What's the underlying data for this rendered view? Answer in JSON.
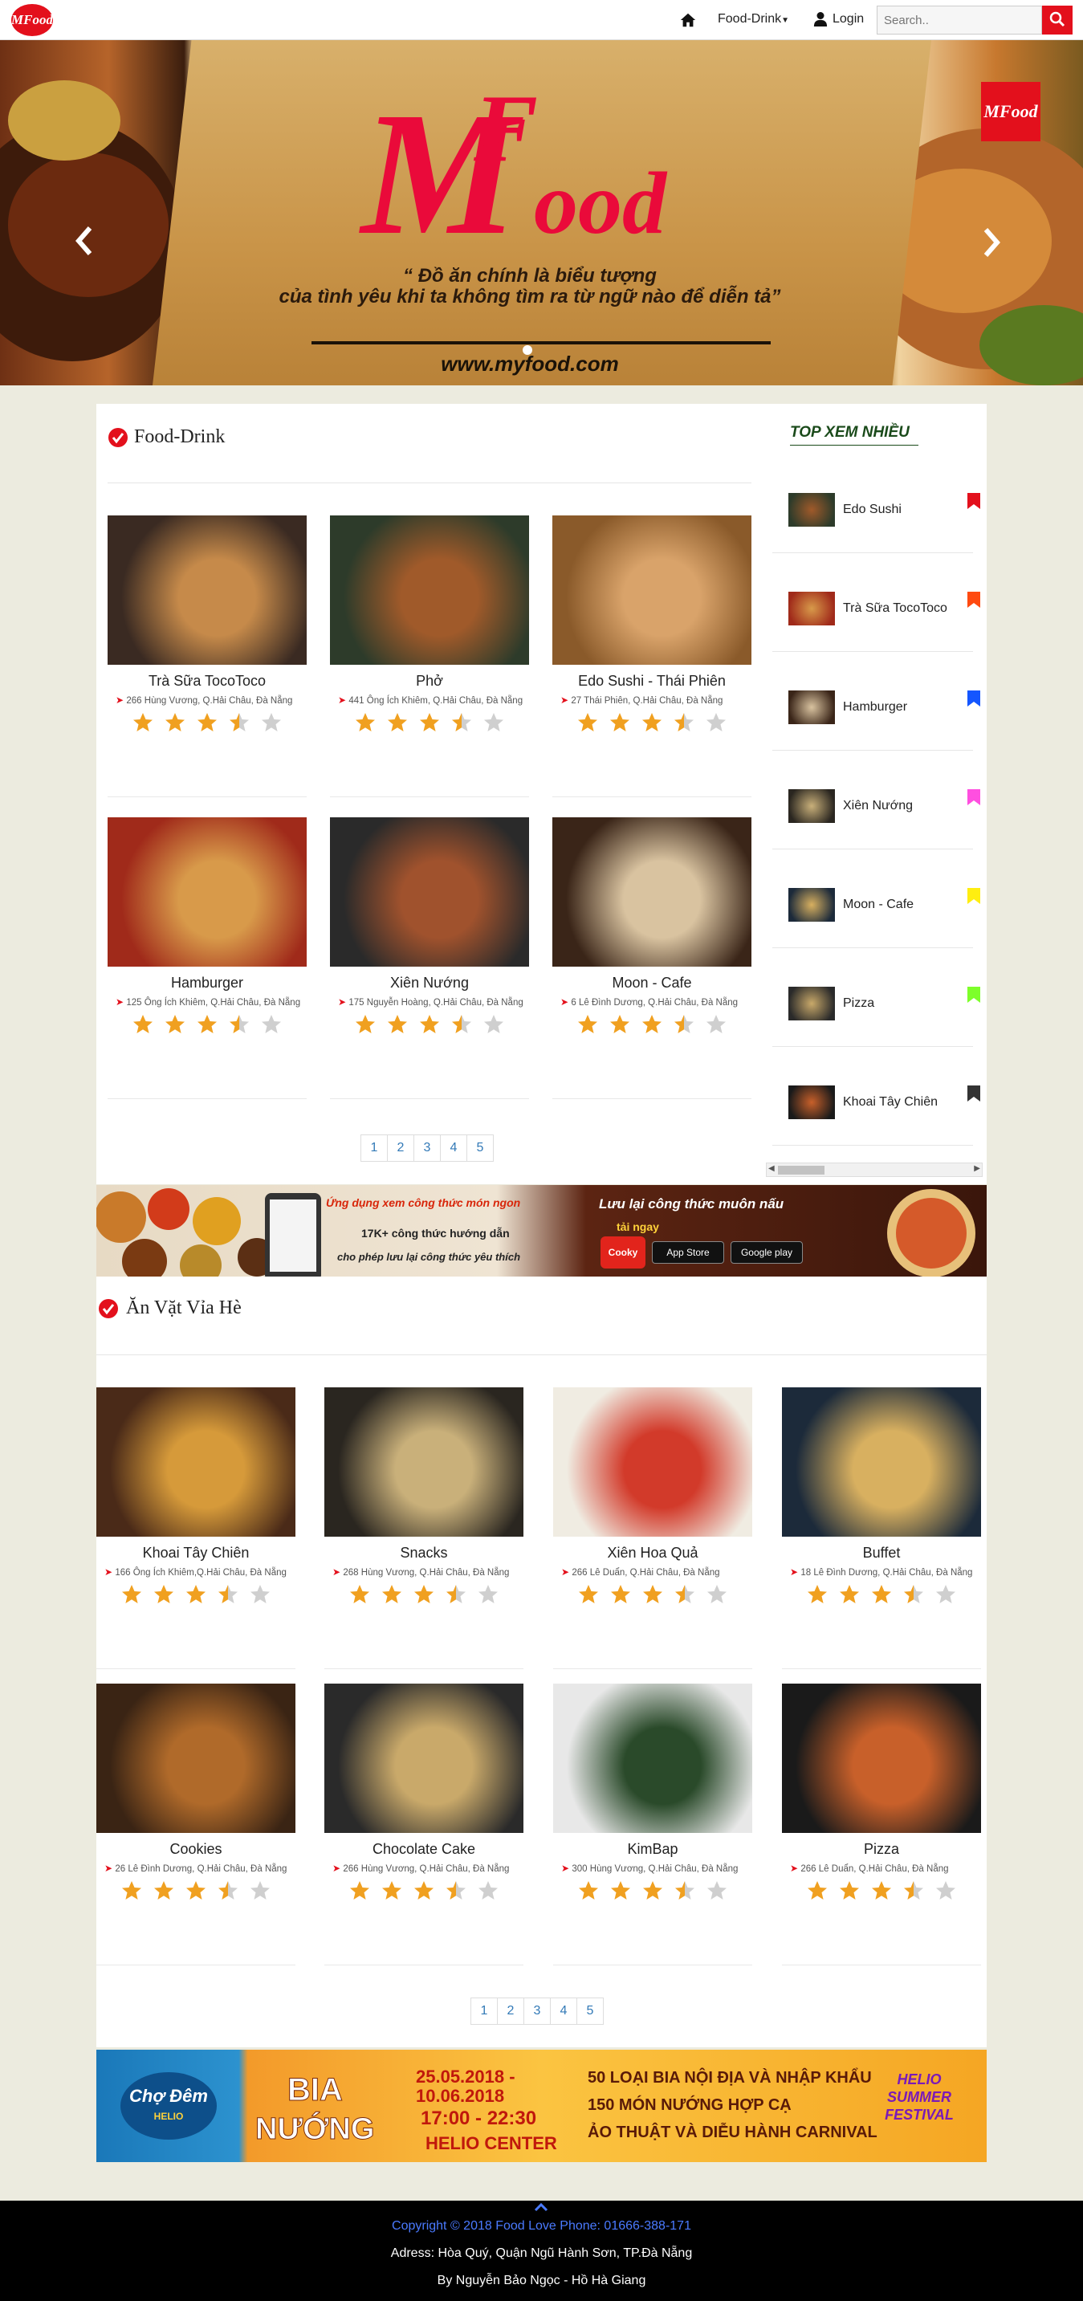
{
  "nav": {
    "logo_text": "MFood",
    "food_drink_label": "Food-Drink",
    "login_label": "Login",
    "search_placeholder": "Search.."
  },
  "hero": {
    "brand": "MFood",
    "quote_line1": "“ Đồ ăn chính là biểu tượng",
    "quote_line2": "của tình yêu khi ta không tìm ra từ ngữ nào để diễn tả”",
    "website": "www.myfood.com",
    "badge": "MFood"
  },
  "section_food_drink": {
    "title": "Food-Drink",
    "items": [
      {
        "name": "Trà Sữa TocoToco",
        "address": "266 Hùng Vương, Q.Hải Châu, Đà Nẵng",
        "rating": 3.5
      },
      {
        "name": "Phở",
        "address": "441 Ông Ích Khiêm, Q.Hải Châu, Đà Nẵng",
        "rating": 3.5
      },
      {
        "name": "Edo Sushi - Thái Phiên",
        "address": "27 Thái Phiên, Q.Hải Châu, Đà Nẵng",
        "rating": 3.5
      },
      {
        "name": "Hamburger",
        "address": "125 Ông Ích Khiêm, Q.Hải Châu, Đà Nẵng",
        "rating": 3.5
      },
      {
        "name": "Xiên Nướng",
        "address": "175 Nguyễn Hoàng, Q.Hải Châu, Đà Nẵng",
        "rating": 3.5
      },
      {
        "name": "Moon - Cafe",
        "address": "6 Lê Đình Dương, Q.Hải Châu, Đà Nẵng",
        "rating": 3.5
      }
    ],
    "pages": [
      "1",
      "2",
      "3",
      "4",
      "5"
    ]
  },
  "top_views": {
    "title": "TOP XEM NHIỀU",
    "items": [
      {
        "label": "Edo Sushi",
        "flag_color": "#e3101c"
      },
      {
        "label": "Trà Sữa TocoToco",
        "flag_color": "#ff4a10"
      },
      {
        "label": "Hamburger",
        "flag_color": "#1456ff"
      },
      {
        "label": "Xiên Nướng",
        "flag_color": "#ff4fe0"
      },
      {
        "label": "Moon - Cafe",
        "flag_color": "#ffee10"
      },
      {
        "label": "Pizza",
        "flag_color": "#7dff2a"
      },
      {
        "label": "Khoai Tây Chiên",
        "flag_color": "#333333"
      }
    ]
  },
  "ad_cooky": {
    "left_heading": "Ứng dụng xem công thức món ngon",
    "left_line1": "17K+ công thức hướng dẫn",
    "left_line2": "cho phép lưu lại công thức yêu thích",
    "right_heading": "Lưu lại công thức muôn nấu",
    "right_cta": "tải ngay",
    "brand": "Cooky",
    "app_store": "App Store",
    "google_play": "Google play"
  },
  "section_an_vat": {
    "title": "Ăn Vặt Vỉa Hè",
    "items": [
      {
        "name": "Khoai Tây Chiên",
        "address": "166 Ông Ích Khiêm,Q.Hải Châu, Đà Nẵng",
        "rating": 3.5
      },
      {
        "name": "Snacks",
        "address": "268 Hùng Vương, Q.Hải Châu, Đà Nẵng",
        "rating": 3.5
      },
      {
        "name": "Xiên Hoa Quả",
        "address": "266 Lê Duẩn, Q.Hải Châu, Đà Nẵng",
        "rating": 3.5
      },
      {
        "name": "Buffet",
        "address": "18 Lê Đình Dương, Q.Hải Châu, Đà Nẵng",
        "rating": 3.5
      },
      {
        "name": "Cookies",
        "address": "26 Lê Đình Dương, Q.Hải Châu, Đà Nẵng",
        "rating": 3.5
      },
      {
        "name": "Chocolate Cake",
        "address": "266 Hùng Vương, Q.Hải Châu, Đà Nẵng",
        "rating": 3.5
      },
      {
        "name": "KimBap",
        "address": "300 Hùng Vương, Q.Hải Châu, Đà Nẵng",
        "rating": 3.5
      },
      {
        "name": "Pizza",
        "address": "266 Lê Duẩn, Q.Hải Châu, Đà Nẵng",
        "rating": 3.5
      }
    ],
    "pages": [
      "1",
      "2",
      "3",
      "4",
      "5"
    ]
  },
  "ad_festival": {
    "brand": "Chợ Đêm",
    "brand_sub": "HELIO",
    "event_name_1": "BIA",
    "event_name_2": "NƯỚNG",
    "dates": "25.05.2018 - 10.06.2018",
    "time": "17:00 - 22:30",
    "venue": "HELIO CENTER",
    "line1": "50 LOẠI BIA NỘI ĐỊA VÀ NHẬP KHẨU",
    "line2": "150 MÓN NƯỚNG HỢP CẠ",
    "line3": "ẢO THUẬT VÀ DIỄU HÀNH CARNIVAL",
    "badge": "HELIO SUMMER FESTIVAL"
  },
  "footer": {
    "copyright": "Copyright © 2018 Food Love Phone: 01666-388-171",
    "address": "Adress: Hòa Quý, Quận Ngũ Hành Sơn, TP.Đà Nẵng",
    "author": "By Nguyễn Bảo Ngọc - Hồ Hà Giang"
  },
  "colors": {
    "brand_red": "#e3101c",
    "link_blue": "#337ab7",
    "footer_blue": "#4a7aff",
    "page_bg": "#ecebdf"
  }
}
